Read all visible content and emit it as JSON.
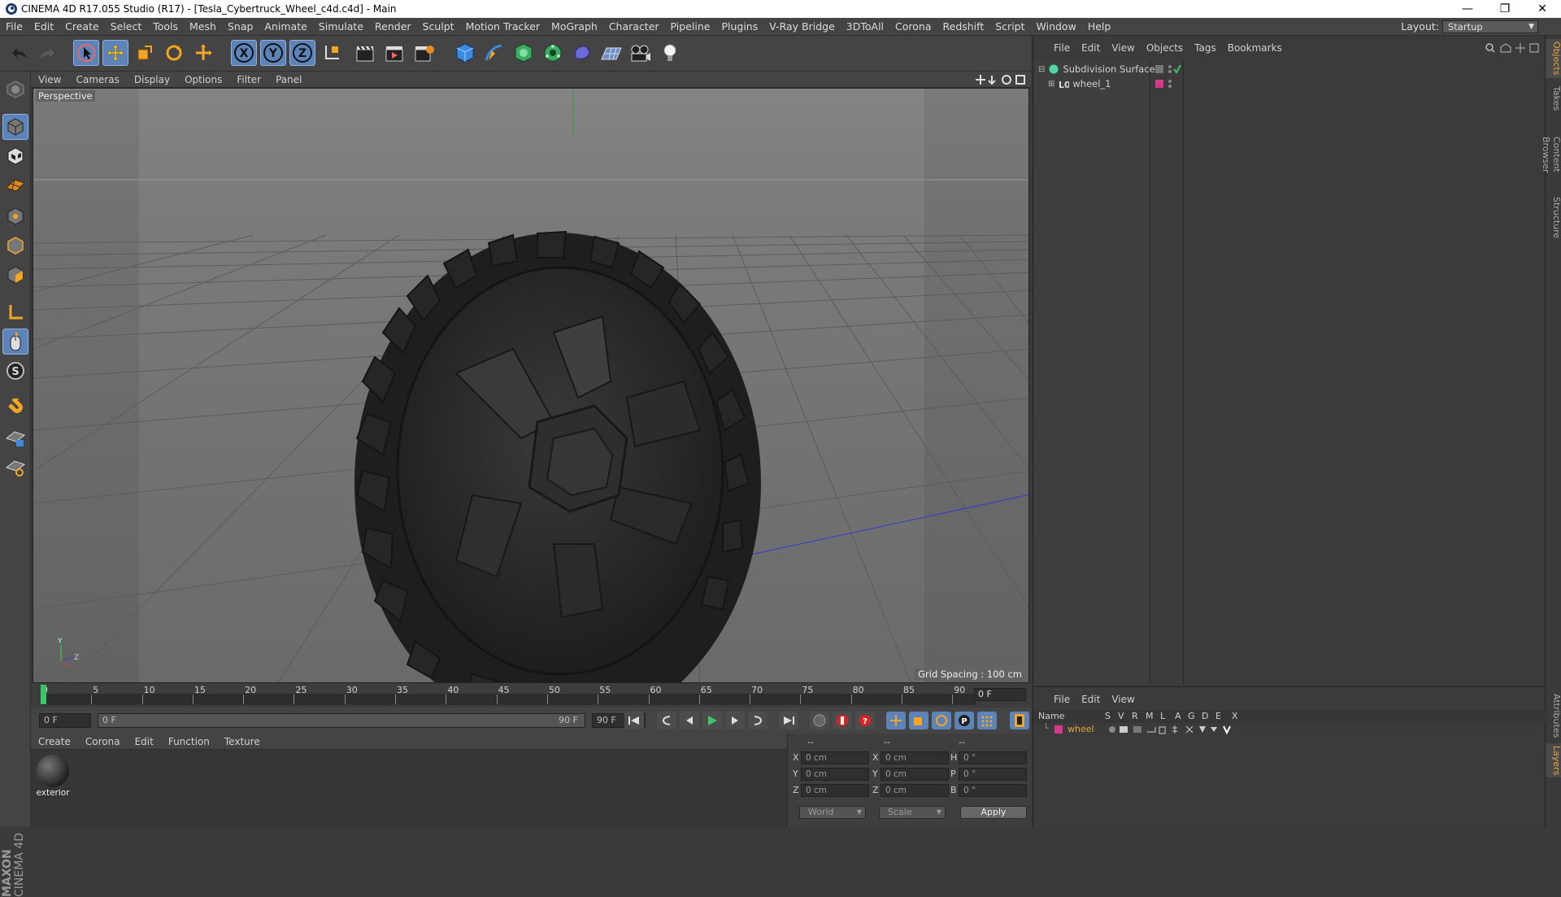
{
  "window": {
    "title": "CINEMA 4D R17.055 Studio (R17) - [Tesla_Cybertruck_Wheel_c4d.c4d] - Main",
    "minimize": "—",
    "restore": "❐",
    "close": "✕"
  },
  "menubar": {
    "items": [
      "File",
      "Edit",
      "Create",
      "Select",
      "Tools",
      "Mesh",
      "Snap",
      "Animate",
      "Simulate",
      "Render",
      "Sculpt",
      "Motion Tracker",
      "MoGraph",
      "Character",
      "Pipeline",
      "Plugins",
      "V-Ray Bridge",
      "3DToAll",
      "Corona",
      "Redshift",
      "Script",
      "Window",
      "Help"
    ],
    "layout_label": "Layout:",
    "layout_value": "Startup"
  },
  "viewport": {
    "menu": [
      "View",
      "Cameras",
      "Display",
      "Options",
      "Filter",
      "Panel"
    ],
    "label": "Perspective",
    "grid_spacing": "Grid Spacing : 100 cm"
  },
  "timeline": {
    "ticks": [
      "0",
      "5",
      "10",
      "15",
      "20",
      "25",
      "30",
      "35",
      "40",
      "45",
      "50",
      "55",
      "60",
      "65",
      "70",
      "75",
      "80",
      "85",
      "90"
    ],
    "current_frame": "0 F"
  },
  "transport": {
    "start_field": "0 F",
    "range_start": "0 F",
    "range_end": "90 F",
    "end_field": "90 F"
  },
  "material_manager": {
    "menu": [
      "Create",
      "Corona",
      "Edit",
      "Function",
      "Texture"
    ],
    "materials": [
      {
        "name": "exterior"
      }
    ]
  },
  "coordinates": {
    "headers": [
      "--",
      "--",
      "--"
    ],
    "rows": [
      {
        "a": "X",
        "av": "0 cm",
        "b": "X",
        "bv": "0 cm",
        "c": "H",
        "cv": "0 °"
      },
      {
        "a": "Y",
        "av": "0 cm",
        "b": "Y",
        "bv": "0 cm",
        "c": "P",
        "cv": "0 °"
      },
      {
        "a": "Z",
        "av": "0 cm",
        "b": "Z",
        "bv": "0 cm",
        "c": "B",
        "cv": "0 °"
      }
    ],
    "space": "World",
    "mode": "Scale",
    "apply": "Apply"
  },
  "object_manager": {
    "menu": [
      "File",
      "Edit",
      "View",
      "Objects",
      "Tags",
      "Bookmarks"
    ],
    "objects": [
      {
        "name": "Subdivision Surface",
        "color": "#5ad3a4"
      },
      {
        "name": "wheel_1",
        "color": "#d33a8d"
      }
    ]
  },
  "side_tabs": [
    "Objects",
    "Takes",
    "Content Browser",
    "Structure"
  ],
  "side_tabs_bottom": [
    "Attributes",
    "Layers"
  ],
  "layer_manager": {
    "menu": [
      "File",
      "Edit",
      "View"
    ],
    "columns": [
      "Name",
      "S",
      "V",
      "R",
      "M",
      "L",
      "A",
      "G",
      "D",
      "E",
      "X"
    ],
    "layers": [
      {
        "name": "wheel",
        "color": "#d33a8d"
      }
    ]
  },
  "brand": {
    "maxon": "MAXON",
    "cinema": "CINEMA 4D"
  },
  "colors": {
    "accent": "#5d84b8",
    "layer": "#d33a8d",
    "label_orange": "#e8a640"
  }
}
